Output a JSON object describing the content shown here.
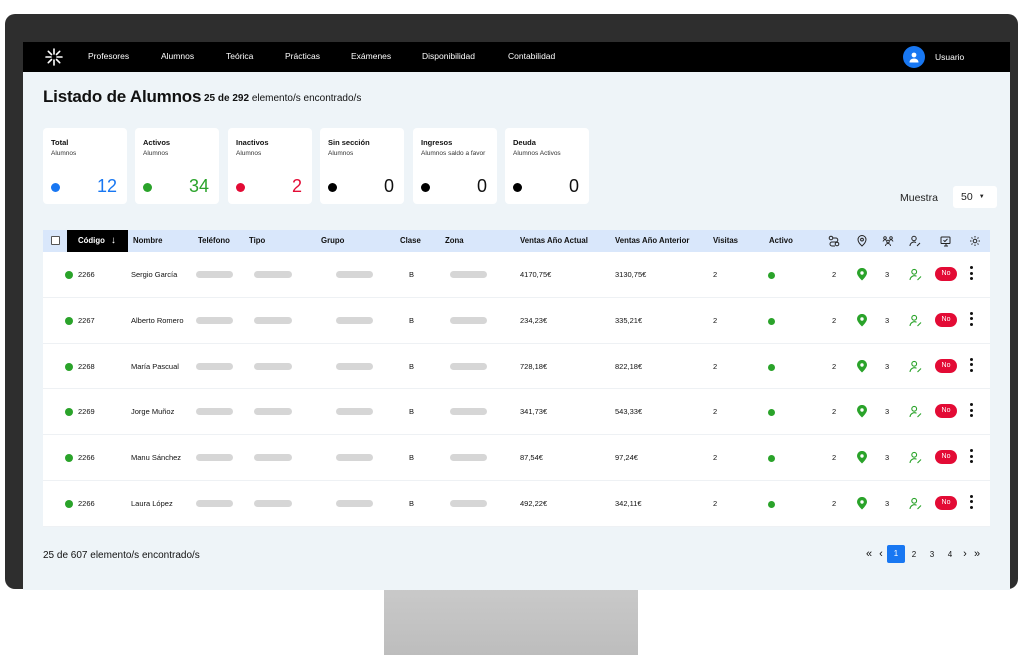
{
  "nav": {
    "items": [
      "Profesores",
      "Alumnos",
      "Teórica",
      "Prácticas",
      "Exámenes",
      "Disponibilidad",
      "Contabilidad"
    ],
    "user_label": "Usuario"
  },
  "page": {
    "title": "Listado de Alumnos",
    "count_strong": "25 de 292",
    "count_rest": " elemento/s encontrado/s"
  },
  "cards": [
    {
      "title": "Total",
      "sub": "Alumnos",
      "value": "12",
      "dot_color": "#1877f2",
      "value_color": "#1877f2"
    },
    {
      "title": "Activos",
      "sub": "Alumnos",
      "value": "34",
      "dot_color": "#2aa32a",
      "value_color": "#2aa32a"
    },
    {
      "title": "Inactivos",
      "sub": "Alumnos",
      "value": "2",
      "dot_color": "#e30b35",
      "value_color": "#e30b35"
    },
    {
      "title": "Sin sección",
      "sub": "Alumnos",
      "value": "0",
      "dot_color": "#000000",
      "value_color": "#111111"
    },
    {
      "title": "Ingresos",
      "sub": "Alumnos saldo a favor",
      "value": "0",
      "dot_color": "#000000",
      "value_color": "#111111"
    },
    {
      "title": "Deuda",
      "sub": "Alumnos Activos",
      "value": "0",
      "dot_color": "#000000",
      "value_color": "#111111"
    }
  ],
  "muestra": {
    "label": "Muestra",
    "value": "50"
  },
  "table": {
    "headers": {
      "codigo": "Código",
      "nombre": "Nombre",
      "telefono": "Teléfono",
      "tipo": "Tipo",
      "grupo": "Grupo",
      "clase": "Clase",
      "zona": "Zona",
      "ventas_actual": "Ventas Año Actual",
      "ventas_anterior": "Ventas Año Anterior",
      "visitas": "Visitas",
      "activo": "Activo"
    },
    "header_icons": [
      "route-icon",
      "location-pin-icon",
      "group-icon",
      "user-edit-icon",
      "screen-check-icon",
      "gear-icon"
    ],
    "rows": [
      {
        "codigo": "2266",
        "nombre": "Sergio García",
        "clase": "B",
        "ventas_actual": "4170,75€",
        "ventas_anterior": "3130,75€",
        "visitas": "2",
        "c1": "2",
        "c2": "3",
        "badge": "No"
      },
      {
        "codigo": "2267",
        "nombre": "Alberto Romero",
        "clase": "B",
        "ventas_actual": "234,23€",
        "ventas_anterior": "335,21€",
        "visitas": "2",
        "c1": "2",
        "c2": "3",
        "badge": "No"
      },
      {
        "codigo": "2268",
        "nombre": "María Pascual",
        "clase": "B",
        "ventas_actual": "728,18€",
        "ventas_anterior": "822,18€",
        "visitas": "2",
        "c1": "2",
        "c2": "3",
        "badge": "No"
      },
      {
        "codigo": "2269",
        "nombre": "Jorge Muñoz",
        "clase": "B",
        "ventas_actual": "341,73€",
        "ventas_anterior": "543,33€",
        "visitas": "2",
        "c1": "2",
        "c2": "3",
        "badge": "No"
      },
      {
        "codigo": "2266",
        "nombre": "Manu Sánchez",
        "clase": "B",
        "ventas_actual": "87,54€",
        "ventas_anterior": "97,24€",
        "visitas": "2",
        "c1": "2",
        "c2": "3",
        "badge": "No"
      },
      {
        "codigo": "2266",
        "nombre": "Laura López",
        "clase": "B",
        "ventas_actual": "492,22€",
        "ventas_anterior": "342,11€",
        "visitas": "2",
        "c1": "2",
        "c2": "3",
        "badge": "No"
      }
    ]
  },
  "footer": {
    "count": "25 de 607 elemento/s encontrado/s",
    "pages": [
      "1",
      "2",
      "3",
      "4"
    ],
    "active_page": "1"
  },
  "colors": {
    "accent": "#1877f2",
    "success": "#2aa32a",
    "danger": "#e30b35"
  }
}
